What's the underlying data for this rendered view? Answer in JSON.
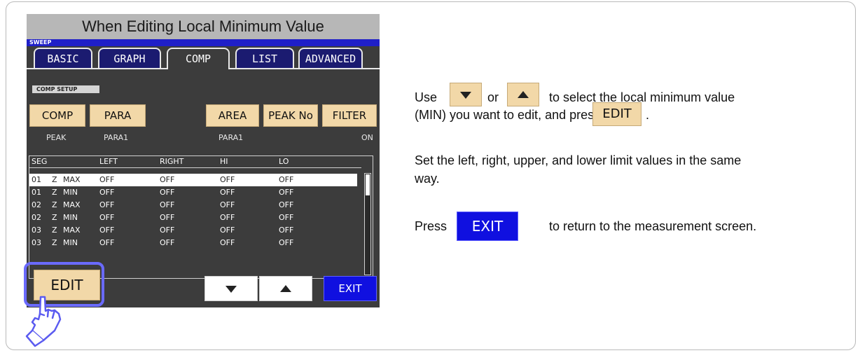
{
  "caption": "When Editing Local Minimum Value",
  "screen": {
    "sweep_label": "SWEEP",
    "tabs": [
      {
        "label": "BASIC",
        "active": false
      },
      {
        "label": "GRAPH",
        "active": false
      },
      {
        "label": "COMP",
        "active": true
      },
      {
        "label": "LIST",
        "active": false
      },
      {
        "label": "ADVANCED",
        "active": false
      }
    ],
    "section_label": "COMP SETUP",
    "function_buttons": {
      "comp": "COMP",
      "para": "PARA",
      "area": "AREA",
      "peak_no": "PEAK No",
      "filter": "FILTER"
    },
    "function_values": {
      "comp": "PEAK",
      "para": "PARA1",
      "area": "PARA1",
      "filter": "ON"
    },
    "table": {
      "headers": [
        "SEG",
        "LEFT",
        "RIGHT",
        "HI",
        "LO"
      ],
      "rows": [
        {
          "seg": "01",
          "param": "Z",
          "type": "MAX",
          "left": "OFF",
          "right": "OFF",
          "hi": "OFF",
          "lo": "OFF"
        },
        {
          "seg": "01",
          "param": "Z",
          "type": "MIN",
          "left": "OFF",
          "right": "OFF",
          "hi": "OFF",
          "lo": "OFF"
        },
        {
          "seg": "02",
          "param": "Z",
          "type": "MAX",
          "left": "OFF",
          "right": "OFF",
          "hi": "OFF",
          "lo": "OFF"
        },
        {
          "seg": "02",
          "param": "Z",
          "type": "MIN",
          "left": "OFF",
          "right": "OFF",
          "hi": "OFF",
          "lo": "OFF"
        },
        {
          "seg": "03",
          "param": "Z",
          "type": "MAX",
          "left": "OFF",
          "right": "OFF",
          "hi": "OFF",
          "lo": "OFF"
        },
        {
          "seg": "03",
          "param": "Z",
          "type": "MIN",
          "left": "OFF",
          "right": "OFF",
          "hi": "OFF",
          "lo": "OFF"
        }
      ],
      "selected_row": 0
    },
    "edit_label": "EDIT",
    "exit_label": "EXIT"
  },
  "instructions": {
    "line1_pre": "Use",
    "line1_mid": "or",
    "line1_post": "to select the local minimum value",
    "line2": "(MIN) you want to edit, and press",
    "line2_end": ".",
    "edit_label": "EDIT",
    "para2_line1": "Set the left, right, upper, and lower limit values in the same",
    "para2_line2": "way.",
    "para3_pre": "Press",
    "exit_label": "EXIT",
    "para3_post": "to return to the measurement screen."
  },
  "colors": {
    "screen_bg": "#3c3c3c",
    "tab_bg": "#1b1b70",
    "button_bg": "#f2d8a8",
    "exit_bg": "#1010e0",
    "highlight": "#6a6aff",
    "caption_bg": "#b7b7b7",
    "sweep_bar": "#1f1fc8"
  }
}
